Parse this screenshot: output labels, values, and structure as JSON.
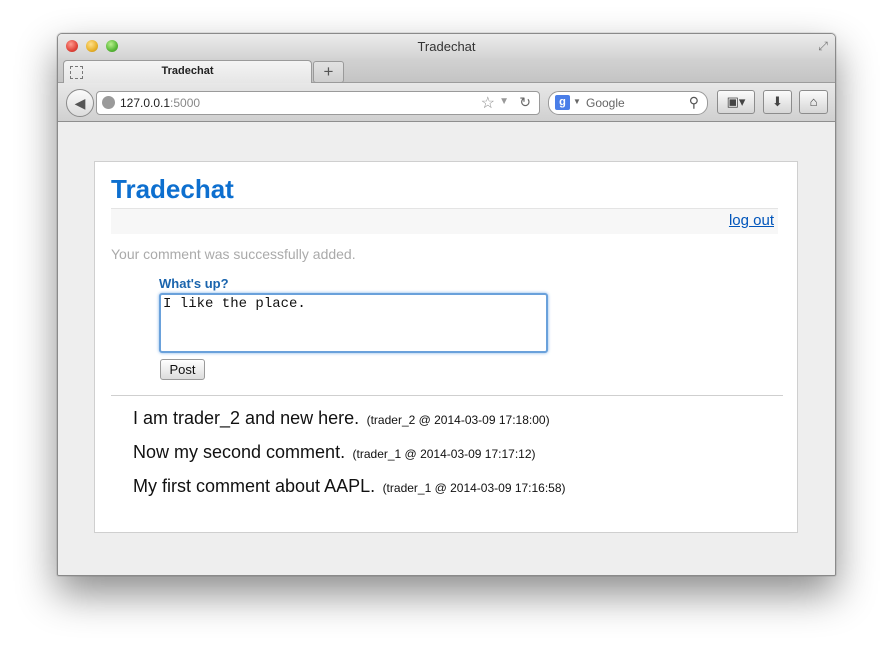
{
  "window": {
    "title": "Tradechat"
  },
  "tabs": [
    {
      "label": "Tradechat"
    }
  ],
  "toolbar": {
    "url_host": "127.0.0.1",
    "url_port": ":5000",
    "search_placeholder": "Google",
    "search_engine_letter": "g"
  },
  "page": {
    "site_title": "Tradechat",
    "logout_label": "log out",
    "flash_message": "Your comment was successfully added.",
    "form_label": "What's up?",
    "comment_value": "I like the place.",
    "post_label": "Post"
  },
  "comments": [
    {
      "text": "I am trader_2 and new here.",
      "meta": "(trader_2 @ 2014-03-09 17:18:00)"
    },
    {
      "text": "Now my second comment.",
      "meta": "(trader_1 @ 2014-03-09 17:17:12)"
    },
    {
      "text": "My first comment about AAPL.",
      "meta": "(trader_1 @ 2014-03-09 17:16:58)"
    }
  ],
  "colors": {
    "title_blue": "#0d6fcf",
    "link_blue": "#0055bb",
    "flash_gray": "#aaaaaa"
  }
}
